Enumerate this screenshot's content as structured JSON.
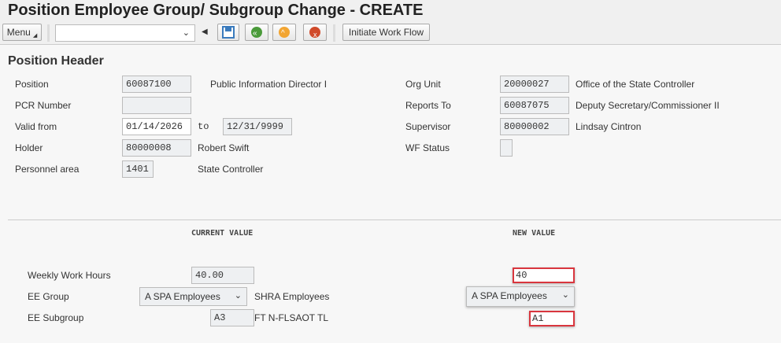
{
  "title": "Position Employee Group/ Subgroup Change - CREATE",
  "toolbar": {
    "menu": "Menu",
    "command_value": "",
    "initiate": "Initiate Work Flow",
    "icons": [
      "save-icon",
      "back-icon",
      "exit-icon",
      "cancel-icon"
    ]
  },
  "section": "Position Header",
  "header": {
    "position_label": "Position",
    "position": "60087100",
    "position_desc": "Public Information Director I",
    "pcr_label": "PCR Number",
    "pcr": "",
    "valid_label": "Valid from",
    "valid_from": "01/14/2026",
    "to": "to",
    "valid_to": "12/31/9999",
    "holder_label": "Holder",
    "holder": "80000008",
    "holder_desc": "Robert Swift",
    "parea_label": "Personnel area",
    "parea": "1401",
    "parea_desc": "State Controller",
    "org_label": "Org Unit",
    "org": "20000027",
    "org_desc": "Office of the State Controller",
    "reports_label": "Reports To",
    "reports": "60087075",
    "reports_desc": "Deputy Secretary/Commissioner II",
    "sup_label": "Supervisor",
    "sup": "80000002",
    "sup_desc": "Lindsay Cintron",
    "wf_label": "WF Status",
    "wf": ""
  },
  "change": {
    "current_header": "CURRENT VALUE",
    "new_header": "NEW VALUE",
    "hours_label": "Weekly Work Hours",
    "hours_current": "40.00",
    "hours_new": "40",
    "group_label": "EE Group",
    "group_current": "A SPA Employees",
    "group_desc": "SHRA Employees",
    "group_new": "A SPA Employees",
    "subgroup_label": "EE Subgroup",
    "subgroup_current": "A3",
    "subgroup_desc": "FT N-FLSAOT TL",
    "subgroup_new": "A1"
  },
  "colors": {
    "highlight": "#d9363e"
  }
}
